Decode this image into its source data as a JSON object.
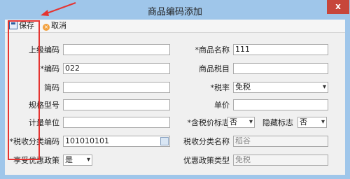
{
  "window": {
    "title": "商品编码添加",
    "close_glyph": "x"
  },
  "toolbar": {
    "save_label": "保存",
    "cancel_label": "取消",
    "cancel_glyph": "×"
  },
  "form": {
    "parent_code_label": "上级编码",
    "parent_code_value": "",
    "product_name_label": "*商品名称",
    "product_name_value": "111",
    "code_label": "*编码",
    "code_value": "022",
    "tax_item_label": "商品税目",
    "tax_item_value": "",
    "short_code_label": "简码",
    "short_code_value": "",
    "tax_rate_label": "*税率",
    "tax_rate_value": "免税",
    "spec_label": "规格型号",
    "spec_value": "",
    "unit_price_label": "单价",
    "unit_price_value": "",
    "unit_label": "计量单位",
    "unit_value": "",
    "tax_incl_label": "*含税价标志",
    "tax_incl_value": "否",
    "hidden_flag_label": "隐藏标志",
    "hidden_flag_value": "否",
    "tax_class_code_label": "*税收分类编码",
    "tax_class_code_value": "101010101",
    "tax_class_name_label": "税收分类名称",
    "tax_class_name_value": "稻谷",
    "preferential_label": "享受优惠政策",
    "preferential_value": "是",
    "preferential_type_label": "优惠政策类型",
    "preferential_type_value": "免税"
  }
}
